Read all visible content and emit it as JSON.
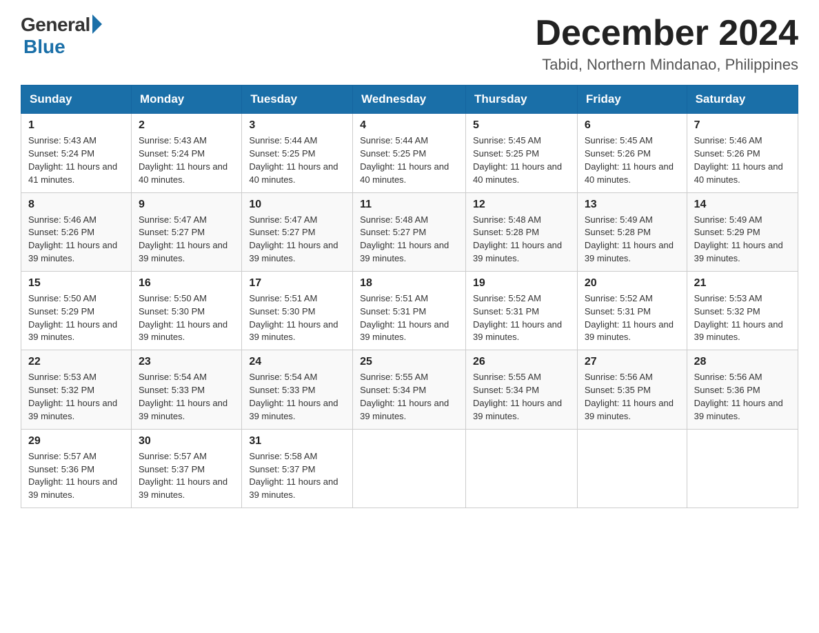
{
  "header": {
    "logo_general": "General",
    "logo_blue": "Blue",
    "month_year": "December 2024",
    "location": "Tabid, Northern Mindanao, Philippines"
  },
  "days_of_week": [
    "Sunday",
    "Monday",
    "Tuesday",
    "Wednesday",
    "Thursday",
    "Friday",
    "Saturday"
  ],
  "weeks": [
    [
      {
        "day": "1",
        "sunrise": "5:43 AM",
        "sunset": "5:24 PM",
        "daylight": "11 hours and 41 minutes."
      },
      {
        "day": "2",
        "sunrise": "5:43 AM",
        "sunset": "5:24 PM",
        "daylight": "11 hours and 40 minutes."
      },
      {
        "day": "3",
        "sunrise": "5:44 AM",
        "sunset": "5:25 PM",
        "daylight": "11 hours and 40 minutes."
      },
      {
        "day": "4",
        "sunrise": "5:44 AM",
        "sunset": "5:25 PM",
        "daylight": "11 hours and 40 minutes."
      },
      {
        "day": "5",
        "sunrise": "5:45 AM",
        "sunset": "5:25 PM",
        "daylight": "11 hours and 40 minutes."
      },
      {
        "day": "6",
        "sunrise": "5:45 AM",
        "sunset": "5:26 PM",
        "daylight": "11 hours and 40 minutes."
      },
      {
        "day": "7",
        "sunrise": "5:46 AM",
        "sunset": "5:26 PM",
        "daylight": "11 hours and 40 minutes."
      }
    ],
    [
      {
        "day": "8",
        "sunrise": "5:46 AM",
        "sunset": "5:26 PM",
        "daylight": "11 hours and 39 minutes."
      },
      {
        "day": "9",
        "sunrise": "5:47 AM",
        "sunset": "5:27 PM",
        "daylight": "11 hours and 39 minutes."
      },
      {
        "day": "10",
        "sunrise": "5:47 AM",
        "sunset": "5:27 PM",
        "daylight": "11 hours and 39 minutes."
      },
      {
        "day": "11",
        "sunrise": "5:48 AM",
        "sunset": "5:27 PM",
        "daylight": "11 hours and 39 minutes."
      },
      {
        "day": "12",
        "sunrise": "5:48 AM",
        "sunset": "5:28 PM",
        "daylight": "11 hours and 39 minutes."
      },
      {
        "day": "13",
        "sunrise": "5:49 AM",
        "sunset": "5:28 PM",
        "daylight": "11 hours and 39 minutes."
      },
      {
        "day": "14",
        "sunrise": "5:49 AM",
        "sunset": "5:29 PM",
        "daylight": "11 hours and 39 minutes."
      }
    ],
    [
      {
        "day": "15",
        "sunrise": "5:50 AM",
        "sunset": "5:29 PM",
        "daylight": "11 hours and 39 minutes."
      },
      {
        "day": "16",
        "sunrise": "5:50 AM",
        "sunset": "5:30 PM",
        "daylight": "11 hours and 39 minutes."
      },
      {
        "day": "17",
        "sunrise": "5:51 AM",
        "sunset": "5:30 PM",
        "daylight": "11 hours and 39 minutes."
      },
      {
        "day": "18",
        "sunrise": "5:51 AM",
        "sunset": "5:31 PM",
        "daylight": "11 hours and 39 minutes."
      },
      {
        "day": "19",
        "sunrise": "5:52 AM",
        "sunset": "5:31 PM",
        "daylight": "11 hours and 39 minutes."
      },
      {
        "day": "20",
        "sunrise": "5:52 AM",
        "sunset": "5:31 PM",
        "daylight": "11 hours and 39 minutes."
      },
      {
        "day": "21",
        "sunrise": "5:53 AM",
        "sunset": "5:32 PM",
        "daylight": "11 hours and 39 minutes."
      }
    ],
    [
      {
        "day": "22",
        "sunrise": "5:53 AM",
        "sunset": "5:32 PM",
        "daylight": "11 hours and 39 minutes."
      },
      {
        "day": "23",
        "sunrise": "5:54 AM",
        "sunset": "5:33 PM",
        "daylight": "11 hours and 39 minutes."
      },
      {
        "day": "24",
        "sunrise": "5:54 AM",
        "sunset": "5:33 PM",
        "daylight": "11 hours and 39 minutes."
      },
      {
        "day": "25",
        "sunrise": "5:55 AM",
        "sunset": "5:34 PM",
        "daylight": "11 hours and 39 minutes."
      },
      {
        "day": "26",
        "sunrise": "5:55 AM",
        "sunset": "5:34 PM",
        "daylight": "11 hours and 39 minutes."
      },
      {
        "day": "27",
        "sunrise": "5:56 AM",
        "sunset": "5:35 PM",
        "daylight": "11 hours and 39 minutes."
      },
      {
        "day": "28",
        "sunrise": "5:56 AM",
        "sunset": "5:36 PM",
        "daylight": "11 hours and 39 minutes."
      }
    ],
    [
      {
        "day": "29",
        "sunrise": "5:57 AM",
        "sunset": "5:36 PM",
        "daylight": "11 hours and 39 minutes."
      },
      {
        "day": "30",
        "sunrise": "5:57 AM",
        "sunset": "5:37 PM",
        "daylight": "11 hours and 39 minutes."
      },
      {
        "day": "31",
        "sunrise": "5:58 AM",
        "sunset": "5:37 PM",
        "daylight": "11 hours and 39 minutes."
      },
      null,
      null,
      null,
      null
    ]
  ],
  "labels": {
    "sunrise_prefix": "Sunrise: ",
    "sunset_prefix": "Sunset: ",
    "daylight_prefix": "Daylight: "
  }
}
